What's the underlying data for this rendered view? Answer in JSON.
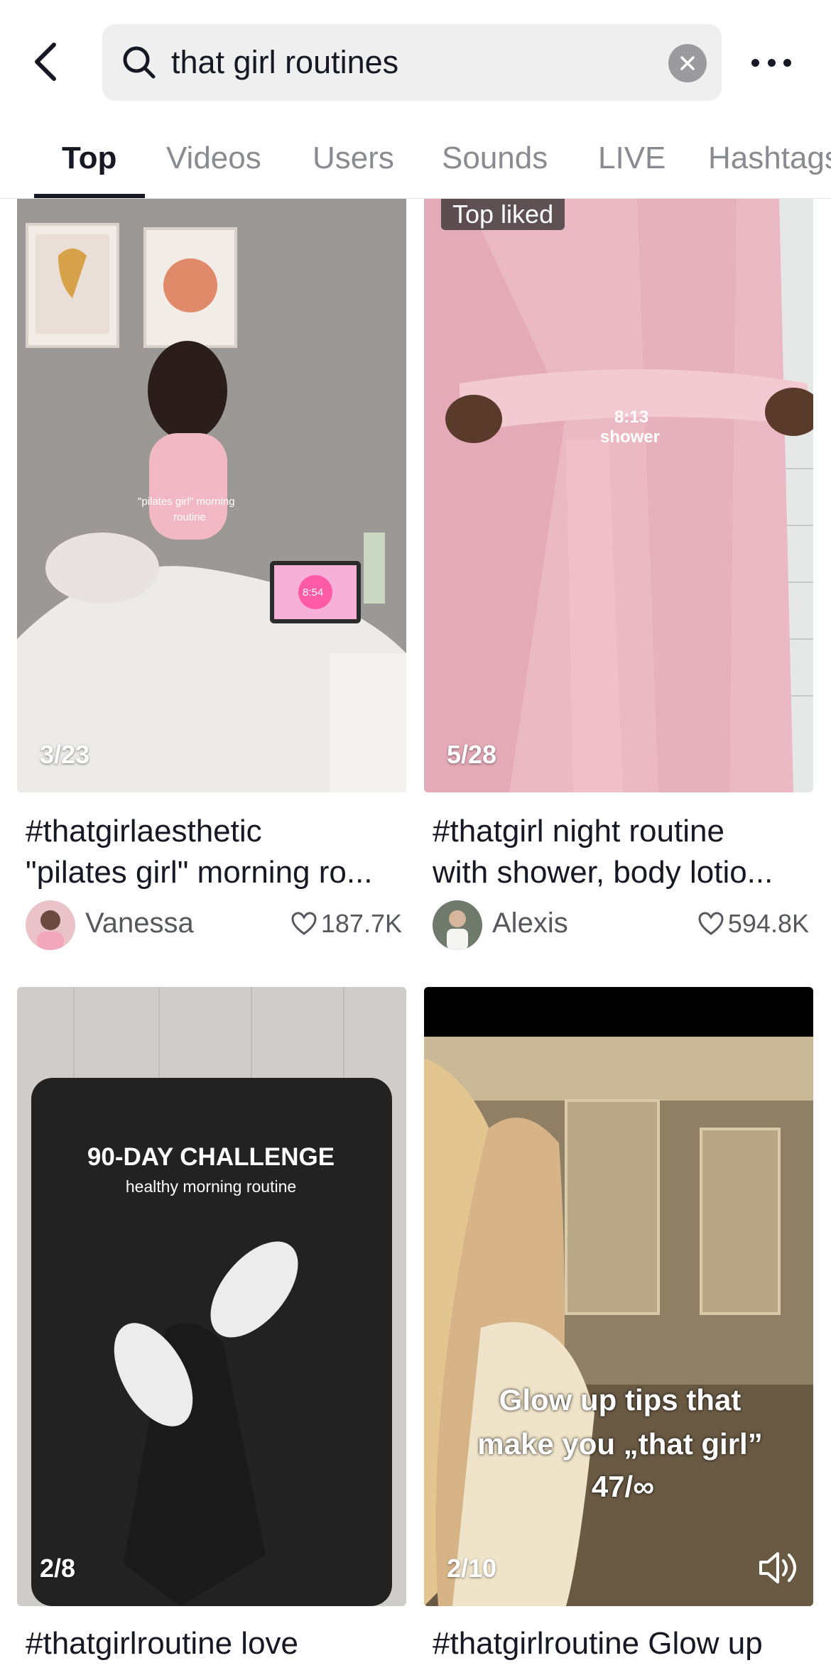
{
  "search": {
    "query": "that girl routines"
  },
  "tabs": [
    "Top",
    "Videos",
    "Users",
    "Sounds",
    "LIVE",
    "Hashtags"
  ],
  "results": [
    {
      "counter": "3/23",
      "overlay_text_1": "\"pilates girl\" morning",
      "overlay_text_2": "routine",
      "overlay_time": "8:54",
      "caption_line1": "#thatgirlaesthetic",
      "caption_line2": "\"pilates girl\" morning ro...",
      "author": "Vanessa",
      "likes": "187.7K"
    },
    {
      "badge": "Top liked",
      "counter": "5/28",
      "overlay_text_1": "8:13",
      "overlay_text_2": "shower",
      "caption_line1": "#thatgirl night routine",
      "caption_line2": "with shower, body lotio...",
      "author": "Alexis",
      "likes": "594.8K"
    },
    {
      "counter": "2/8",
      "overlay_text_1": "90-DAY CHALLENGE",
      "overlay_text_2": "healthy morning routine",
      "caption_line1": "#thatgirlroutine love"
    },
    {
      "counter": "2/10",
      "overlay_text_1": "Glow up tips that",
      "overlay_text_2": "make you „that girl”",
      "overlay_text_3": "47/∞",
      "caption_line1": "#thatgirlroutine Glow up"
    }
  ],
  "colors": {
    "text": "#161823",
    "muted": "#8a8b91",
    "search_bg": "#efeff0"
  },
  "icons": [
    "back-arrow-icon",
    "search-icon",
    "clear-icon",
    "more-icon",
    "heart-icon",
    "speaker-icon"
  ]
}
